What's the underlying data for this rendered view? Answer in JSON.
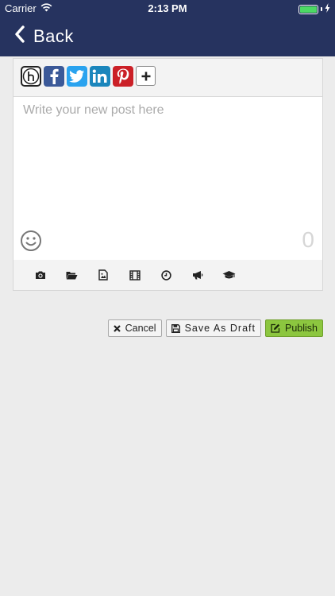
{
  "status_bar": {
    "carrier": "Carrier",
    "time": "2:13 PM",
    "battery_level": 1.0,
    "icons": [
      "wifi-icon",
      "battery-icon",
      "charging-icon"
    ]
  },
  "nav": {
    "back_label": "Back",
    "background_color": "#26335f"
  },
  "share_buttons": [
    {
      "name": "h-network",
      "glyph": "h"
    },
    {
      "name": "facebook",
      "glyph": "f"
    },
    {
      "name": "twitter",
      "glyph": "t"
    },
    {
      "name": "linkedin",
      "glyph": "in"
    },
    {
      "name": "pinterest",
      "glyph": "p"
    },
    {
      "name": "add",
      "glyph": "+"
    }
  ],
  "editor": {
    "placeholder": "Write your new post here",
    "value": "",
    "char_count": "0"
  },
  "media_toolbar": [
    "camera-icon",
    "folder-icon",
    "image-icon",
    "film-icon",
    "clock-icon",
    "megaphone-icon",
    "graduation-cap-icon"
  ],
  "actions": {
    "cancel_label": "Cancel",
    "draft_label": "Save As Draft",
    "publish_label": "Publish",
    "publish_color": "#8cc63f"
  }
}
